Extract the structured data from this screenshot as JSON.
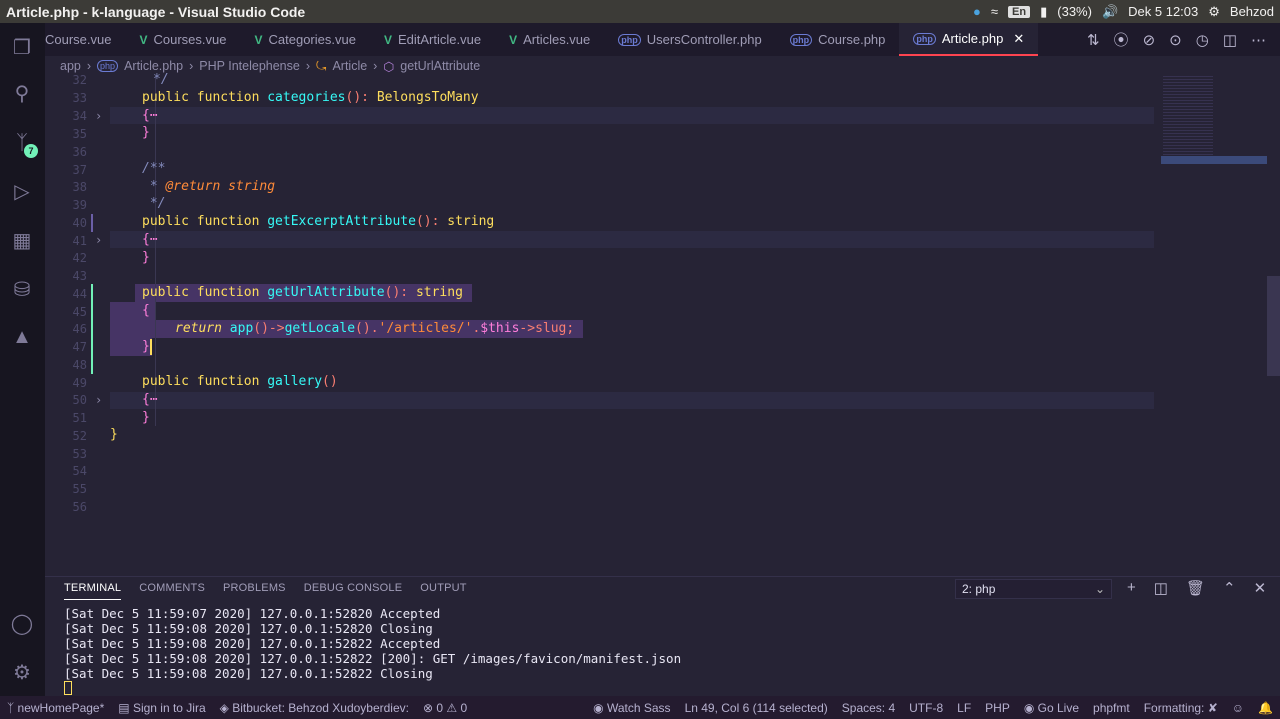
{
  "os": {
    "title": "Article.php - k-language - Visual Studio Code",
    "lang": "En",
    "battery": "(33%)",
    "clock": "Dek  5 12:03",
    "user": "Behzod"
  },
  "activity": {
    "scm_badge": "7"
  },
  "tabs": [
    {
      "label": "Course.vue",
      "kind": "vue"
    },
    {
      "label": "Courses.vue",
      "kind": "vue"
    },
    {
      "label": "Categories.vue",
      "kind": "vue"
    },
    {
      "label": "EditArticle.vue",
      "kind": "vue"
    },
    {
      "label": "Articles.vue",
      "kind": "vue"
    },
    {
      "label": "UsersController.php",
      "kind": "php"
    },
    {
      "label": "Course.php",
      "kind": "php"
    },
    {
      "label": "Article.php",
      "kind": "php",
      "active": true
    }
  ],
  "breadcrumb": [
    "app",
    "Article.php",
    "PHP Intelephense",
    "Article",
    "getUrlAttribute"
  ],
  "line_numbers": [
    "32",
    "33",
    "34",
    "35",
    "36",
    "37",
    "38",
    "39",
    "40",
    "41",
    "42",
    "43",
    "44",
    "45",
    "46",
    "47",
    "48",
    "49",
    "50",
    "51",
    "52",
    "53",
    "54",
    "55",
    "56"
  ],
  "code": {
    "l32": "*/",
    "l33a": "public function ",
    "l33b": "categories",
    "l33c": "(): ",
    "l33d": "BelongsToMany",
    "l34": "{⋯",
    "l35": "}",
    "l37": "/**",
    "l38a": " * ",
    "l38b": "@return string",
    "l39": " */",
    "l40a": "public function ",
    "l40b": "getExcerptAttribute",
    "l40c": "(): ",
    "l40d": "string",
    "l41": "{⋯",
    "l42": "}",
    "l44a": "public function ",
    "l44b": "getUrlAttribute",
    "l44c": "(): ",
    "l44d": "string",
    "l45": "{",
    "l46a": "return ",
    "l46b": "app",
    "l46c": "()->",
    "l46d": "getLocale",
    "l46e": "().",
    "l46f": "'/articles/'",
    "l46g": ".",
    "l46h": "$this",
    "l46i": "->slug;",
    "l47": "}",
    "l49a": "public function ",
    "l49b": "gallery",
    "l49c": "()",
    "l50": "{⋯",
    "l51": "}",
    "l52": "}"
  },
  "panel": {
    "tabs": [
      "TERMINAL",
      "COMMENTS",
      "PROBLEMS",
      "DEBUG CONSOLE",
      "OUTPUT"
    ],
    "terminal_select": "2: php",
    "lines": [
      "[Sat Dec  5 11:59:07 2020] 127.0.0.1:52820 Accepted",
      "[Sat Dec  5 11:59:08 2020] 127.0.0.1:52820 Closing",
      "[Sat Dec  5 11:59:08 2020] 127.0.0.1:52822 Accepted",
      "[Sat Dec  5 11:59:08 2020] 127.0.0.1:52822 [200]: GET /images/favicon/manifest.json",
      "[Sat Dec  5 11:59:08 2020] 127.0.0.1:52822 Closing"
    ]
  },
  "status": {
    "branch": "newHomePage*",
    "jira": "Sign in to Jira",
    "bitbucket": "Bitbucket: Behzod Xudoyberdiev:",
    "problems": "⊗ 0 ⚠ 0",
    "sass": "Watch Sass",
    "position": "Ln 49, Col 6 (114 selected)",
    "spaces": "Spaces: 4",
    "encoding": "UTF-8",
    "eol": "LF",
    "language": "PHP",
    "golive": "Go Live",
    "phpfmt": "phpfmt",
    "formatting": "Formatting: ✘"
  },
  "colors": {
    "accent": "#fe4450",
    "keyword": "#fede5d",
    "function": "#36f9f6",
    "string": "#ff8b39",
    "background": "#262335"
  }
}
